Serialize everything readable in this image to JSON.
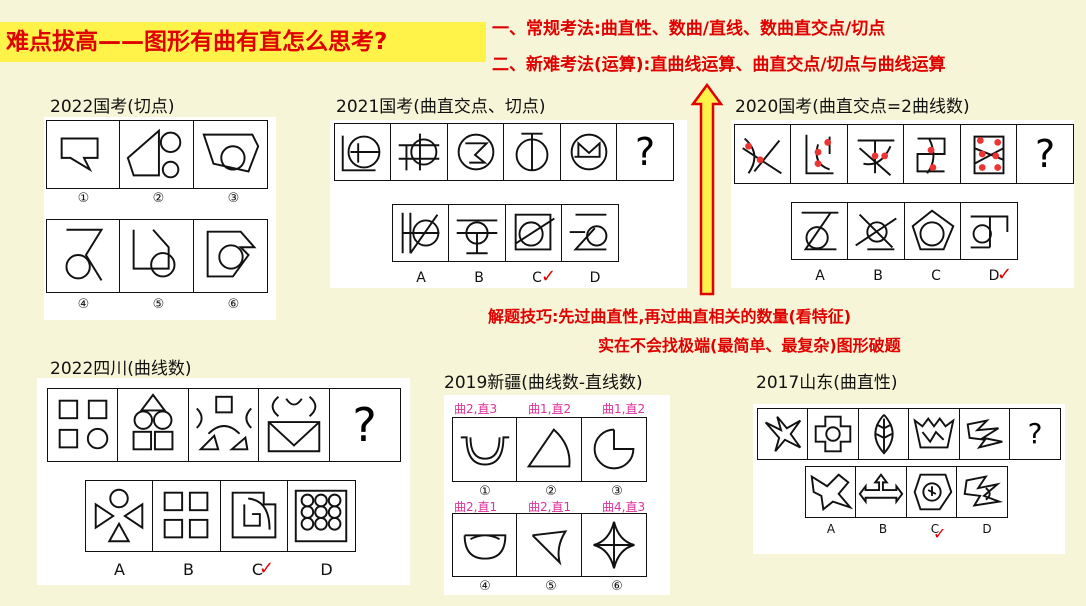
{
  "title": "难点拔高——图形有曲有直怎么思考?",
  "methods": {
    "line1": "一、常规考法:曲直性、数曲/直线、数曲直交点/切点",
    "line2_prefix": "二、新难考法(运算):直",
    "line2_bold1": "曲线",
    "line2_mid": "运算、曲直交点/切点与",
    "line2_bold2": "曲线",
    "line2_suffix": "运算"
  },
  "tip": {
    "line1": "解题技巧:先过曲直性,再过曲直相关的数量(看特征)",
    "line2": "实在不会找极端(最简单、最复杂)图形破题"
  },
  "sections": {
    "guokao2022": {
      "label": "2022国考(切点)",
      "options": [
        "①",
        "②",
        "③",
        "④",
        "⑤",
        "⑥"
      ]
    },
    "guokao2021": {
      "label": "2021国考(曲直交点、切点)",
      "question": "?",
      "options": [
        "A",
        "B",
        "C",
        "D"
      ],
      "answer": "C"
    },
    "guokao2020": {
      "label": "2020国考(曲直交点=2曲线数)",
      "question": "?",
      "options": [
        "A",
        "B",
        "C",
        "D"
      ],
      "answer": "D"
    },
    "sichuan2022": {
      "label": "2022四川(曲线数)",
      "question": "?",
      "options": [
        "A",
        "B",
        "C",
        "D"
      ],
      "answer": "C"
    },
    "xinjiang2019": {
      "label": "2019新疆(曲线数-直线数)",
      "notes": [
        "曲2,直3",
        "曲1,直2",
        "曲1,直2",
        "曲2,直1",
        "曲2,直1",
        "曲4,直3"
      ],
      "options": [
        "①",
        "②",
        "③",
        "④",
        "⑤",
        "⑥"
      ]
    },
    "shandong2017": {
      "label": "2017山东(曲直性)",
      "question": "?",
      "options": [
        "A",
        "B",
        "C",
        "D"
      ],
      "answer": "C"
    }
  },
  "colors": {
    "accent": "#e00000",
    "highlight": "#fff34a",
    "annotation": "#e0309a",
    "background": "#f6f5d7"
  }
}
